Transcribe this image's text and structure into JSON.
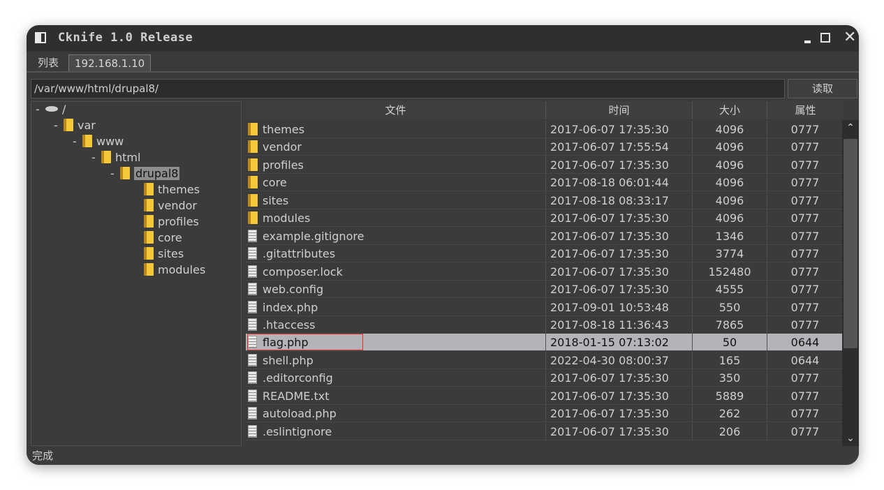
{
  "window": {
    "title": "Cknife 1.0 Release",
    "close_glyph": "✕"
  },
  "tabs": [
    {
      "label": "列表"
    },
    {
      "label": "192.168.1.10"
    }
  ],
  "path": {
    "value": "/var/www/html/drupal8/",
    "read_button": "读取"
  },
  "tree": {
    "root": {
      "dash": "-",
      "label": "/"
    },
    "nodes": [
      {
        "dash": "-",
        "label": "var"
      },
      {
        "dash": "-",
        "label": "www"
      },
      {
        "dash": "-",
        "label": "html"
      },
      {
        "dash": "-",
        "label": "drupal8"
      },
      {
        "label": "themes"
      },
      {
        "label": "vendor"
      },
      {
        "label": "profiles"
      },
      {
        "label": "core"
      },
      {
        "label": "sites"
      },
      {
        "label": "modules"
      }
    ]
  },
  "table": {
    "headers": {
      "name": "文件",
      "time": "时间",
      "size": "大小",
      "attr": "属性"
    },
    "rows": [
      {
        "type": "folder",
        "name": "themes",
        "time": "2017-06-07 17:35:30",
        "size": "4096",
        "attr": "0777"
      },
      {
        "type": "folder",
        "name": "vendor",
        "time": "2017-06-07 17:55:54",
        "size": "4096",
        "attr": "0777"
      },
      {
        "type": "folder",
        "name": "profiles",
        "time": "2017-06-07 17:35:30",
        "size": "4096",
        "attr": "0777"
      },
      {
        "type": "folder",
        "name": "core",
        "time": "2017-08-18 06:01:44",
        "size": "4096",
        "attr": "0777"
      },
      {
        "type": "folder",
        "name": "sites",
        "time": "2017-08-18 08:33:17",
        "size": "4096",
        "attr": "0777"
      },
      {
        "type": "folder",
        "name": "modules",
        "time": "2017-06-07 17:35:30",
        "size": "4096",
        "attr": "0777"
      },
      {
        "type": "file",
        "name": "example.gitignore",
        "time": "2017-06-07 17:35:30",
        "size": "1346",
        "attr": "0777"
      },
      {
        "type": "file",
        "name": ".gitattributes",
        "time": "2017-06-07 17:35:30",
        "size": "3774",
        "attr": "0777"
      },
      {
        "type": "file",
        "name": "composer.lock",
        "time": "2017-06-07 17:35:30",
        "size": "152480",
        "attr": "0777"
      },
      {
        "type": "file",
        "name": "web.config",
        "time": "2017-06-07 17:35:30",
        "size": "4555",
        "attr": "0777"
      },
      {
        "type": "file",
        "name": "index.php",
        "time": "2017-09-01 10:53:48",
        "size": "550",
        "attr": "0777"
      },
      {
        "type": "file",
        "name": ".htaccess",
        "time": "2017-08-18 11:36:43",
        "size": "7865",
        "attr": "0777"
      },
      {
        "type": "file",
        "name": "flag.php",
        "time": "2018-01-15 07:13:02",
        "size": "50",
        "attr": "0644"
      },
      {
        "type": "file",
        "name": "shell.php",
        "time": "2022-04-30 08:00:37",
        "size": "165",
        "attr": "0644"
      },
      {
        "type": "file",
        "name": ".editorconfig",
        "time": "2017-06-07 17:35:30",
        "size": "350",
        "attr": "0777"
      },
      {
        "type": "file",
        "name": "README.txt",
        "time": "2017-06-07 17:35:30",
        "size": "5889",
        "attr": "0777"
      },
      {
        "type": "file",
        "name": "autoload.php",
        "time": "2017-06-07 17:35:30",
        "size": "262",
        "attr": "0777"
      },
      {
        "type": "file",
        "name": ".eslintignore",
        "time": "2017-06-07 17:35:30",
        "size": "206",
        "attr": "0777"
      }
    ],
    "selected_index": 12
  },
  "scrollbar": {
    "up_glyph": "⌃",
    "down_glyph": "⌄"
  },
  "status": {
    "text": "完成"
  }
}
